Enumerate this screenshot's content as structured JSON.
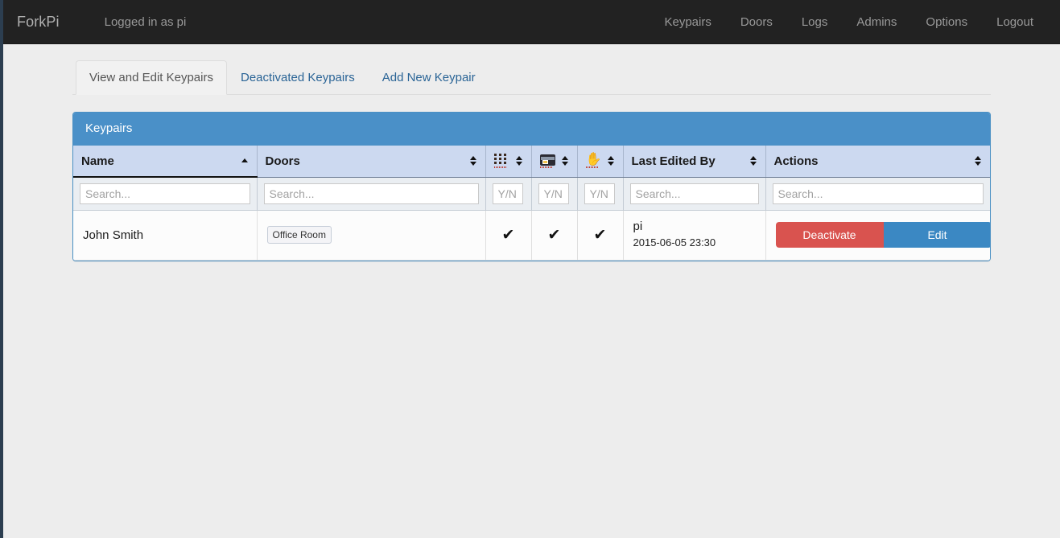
{
  "navbar": {
    "brand": "ForkPi",
    "login_status": "Logged in as pi",
    "links": [
      {
        "label": "Keypairs",
        "name": "nav-keypairs"
      },
      {
        "label": "Doors",
        "name": "nav-doors"
      },
      {
        "label": "Logs",
        "name": "nav-logs"
      },
      {
        "label": "Admins",
        "name": "nav-admins"
      },
      {
        "label": "Options",
        "name": "nav-options"
      },
      {
        "label": "Logout",
        "name": "nav-logout"
      }
    ]
  },
  "tabs": [
    {
      "label": "View and Edit Keypairs",
      "active": true
    },
    {
      "label": "Deactivated Keypairs",
      "active": false
    },
    {
      "label": "Add New Keypair",
      "active": false
    }
  ],
  "panel": {
    "title": "Keypairs"
  },
  "table": {
    "columns": [
      {
        "label": "Name",
        "icon": "",
        "sort": "asc"
      },
      {
        "label": "Doors",
        "icon": "",
        "sort": "none"
      },
      {
        "label": "",
        "icon": "keypad-icon",
        "sort": "none"
      },
      {
        "label": "",
        "icon": "card-icon",
        "sort": "none"
      },
      {
        "label": "",
        "icon": "fingerprint-hand-icon",
        "sort": "none"
      },
      {
        "label": "Last Edited By",
        "icon": "",
        "sort": "none"
      },
      {
        "label": "Actions",
        "icon": "",
        "sort": "none"
      }
    ],
    "filters": [
      {
        "placeholder": "Search...",
        "value": "",
        "kind": "text"
      },
      {
        "placeholder": "Search...",
        "value": "",
        "kind": "text"
      },
      {
        "placeholder": "Y/N",
        "value": "",
        "kind": "yn"
      },
      {
        "placeholder": "Y/N",
        "value": "",
        "kind": "yn"
      },
      {
        "placeholder": "Y/N",
        "value": "",
        "kind": "yn"
      },
      {
        "placeholder": "Search...",
        "value": "",
        "kind": "text"
      },
      {
        "placeholder": "Search...",
        "value": "",
        "kind": "text"
      }
    ],
    "rows": [
      {
        "name": "John Smith",
        "doors": [
          "Office Room"
        ],
        "keypad": "✔",
        "card": "✔",
        "fingerprint": "✔",
        "edited_by": "pi",
        "edited_at": "2015-06-05 23:30",
        "actions": {
          "deactivate_label": "Deactivate",
          "edit_label": "Edit"
        }
      }
    ]
  },
  "colors": {
    "navbar_bg": "#222222",
    "panel_header_bg": "#4a90c8",
    "table_header_bg": "#ccd9f0",
    "page_bg": "#ededed",
    "danger": "#d9534f",
    "primary": "#3b88c3",
    "link": "#2a6496"
  }
}
